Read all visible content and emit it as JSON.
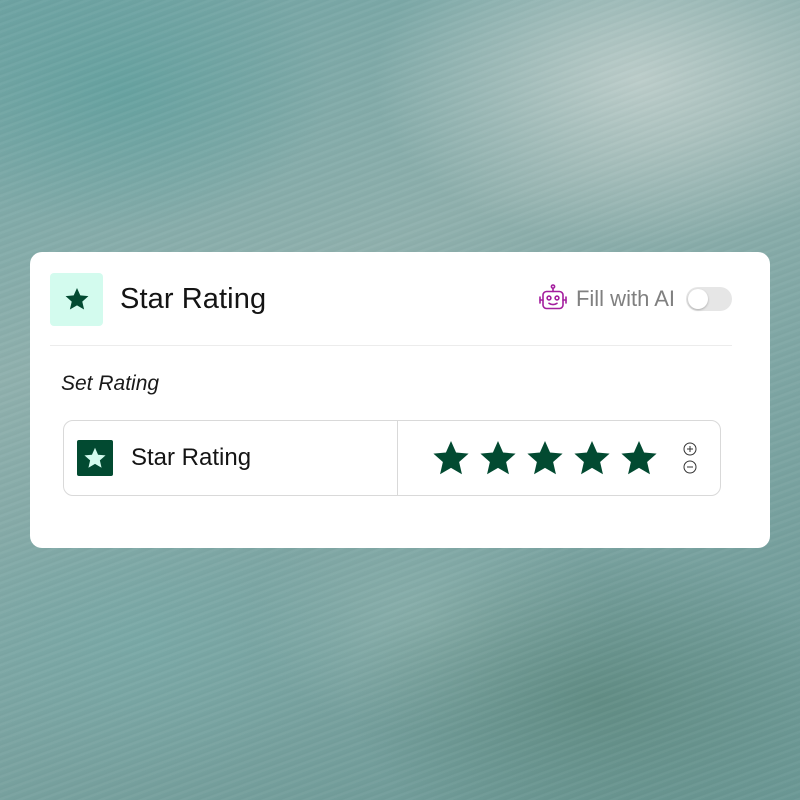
{
  "card": {
    "title": "Star Rating",
    "title_icon": "star-icon",
    "ai": {
      "label": "Fill with AI",
      "icon": "robot-icon",
      "enabled": false
    }
  },
  "section": {
    "label": "Set Rating"
  },
  "rating": {
    "label": "Star Rating",
    "icon": "star-icon",
    "value": 5,
    "max": 5,
    "increment_icon": "plus-circle-icon",
    "decrement_icon": "minus-circle-icon"
  },
  "colors": {
    "brand_dark_green": "#024a31",
    "icon_bg_mint": "#d3fbee",
    "ai_purple": "#a41e9e",
    "toggle_off": "#e6e6e6",
    "muted_text": "#808080"
  }
}
